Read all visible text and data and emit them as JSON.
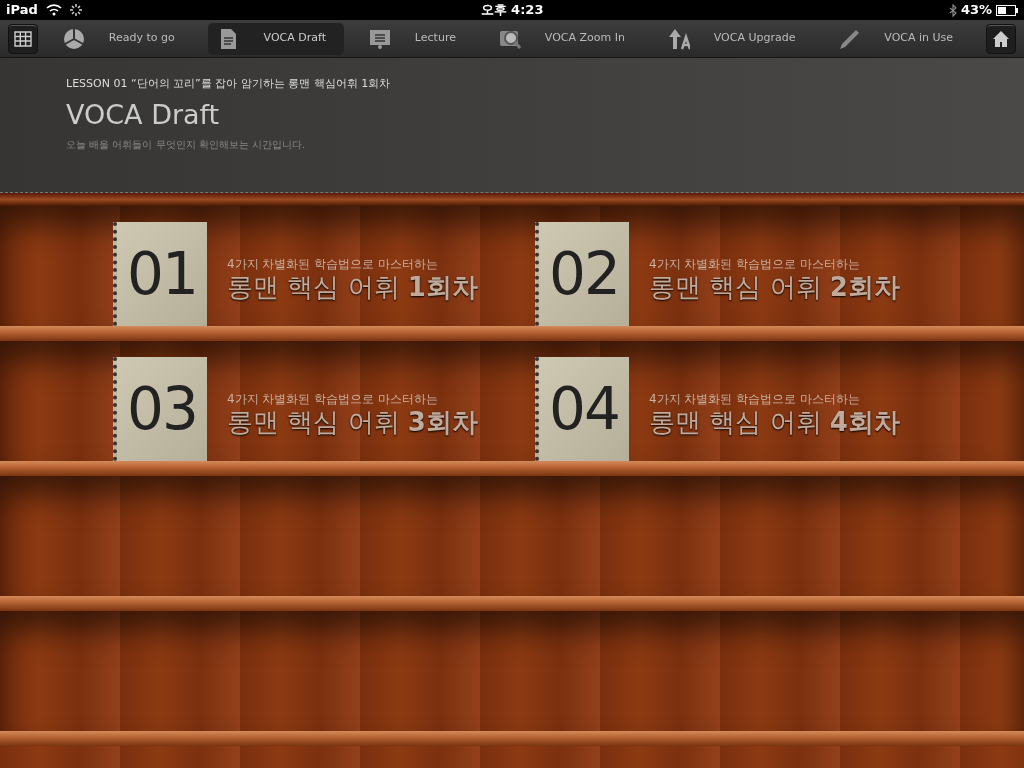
{
  "status_bar": {
    "device": "iPad",
    "time": "오후 4:23",
    "battery": "43%"
  },
  "toolbar": {
    "items": [
      {
        "kind": "cube",
        "label": "Ready to go",
        "selected": false
      },
      {
        "kind": "doc",
        "label": "VOCA Draft",
        "selected": true
      },
      {
        "kind": "board",
        "label": "Lecture",
        "selected": false
      },
      {
        "kind": "zoom",
        "label": "VOCA Zoom In",
        "selected": false
      },
      {
        "kind": "upgrade",
        "label": "VOCA Upgrade",
        "selected": false
      },
      {
        "kind": "pencil",
        "label": "VOCA in Use",
        "selected": false
      }
    ]
  },
  "header": {
    "lesson": "LESSON 01  “단어의 꼬리”를 잡아 암기하는 롱맨 핵심어휘 1회차",
    "title": "VOCA Draft",
    "subtitle": "오늘 배울 어휘들이 무엇인지 확인해보는 시간입니다."
  },
  "shelf": {
    "units": [
      {
        "number": "01",
        "caption": "4가지 차별화된 학습법으로 마스터하는",
        "title": "롱맨 핵심 어휘 **1회차**"
      },
      {
        "number": "02",
        "caption": "4가지 차별화된 학습법으로 마스터하는",
        "title": "롱맨 핵심 어휘 **2회차**"
      },
      {
        "number": "03",
        "caption": "4가지 차별화된 학습법으로 마스터하는",
        "title": "롱맨 핵심 어휘 **3회차**"
      },
      {
        "number": "04",
        "caption": "4가지 차별화된 학습법으로 마스터하는",
        "title": "롱맨 핵심 어휘 **4회차**"
      }
    ]
  }
}
